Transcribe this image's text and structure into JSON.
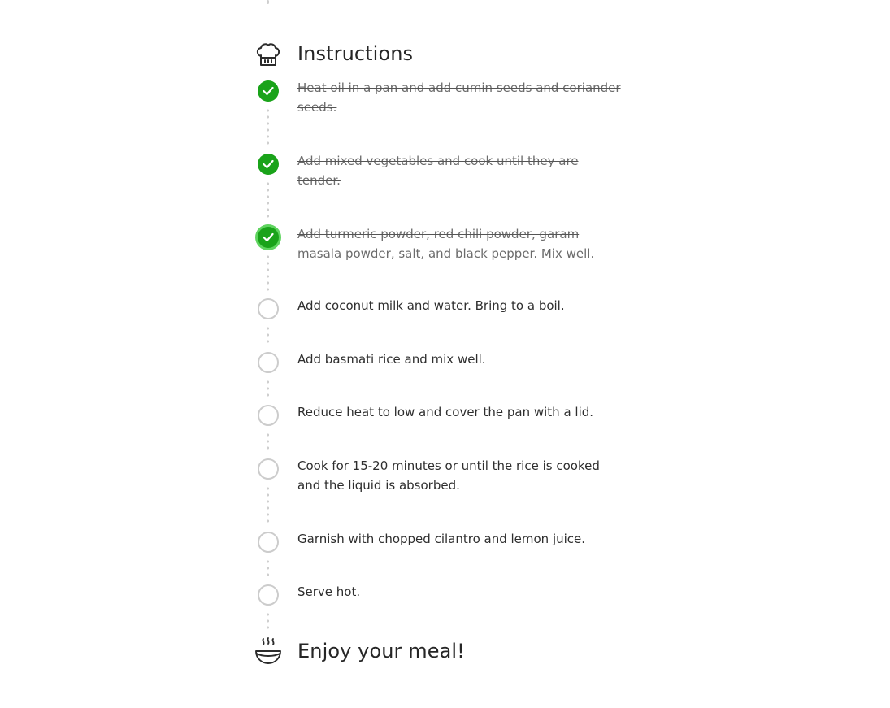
{
  "instructions": {
    "title": "Instructions",
    "header_icon": "chef-hat-icon",
    "steps": [
      {
        "text": "Heat oil in a pan and add cumin seeds and coriander seeds.",
        "completed": true
      },
      {
        "text": "Add mixed vegetables and cook until they are tender.",
        "completed": true
      },
      {
        "text": "Add turmeric powder, red chili powder, garam masala powder, salt, and black pepper. Mix well.",
        "completed": true
      },
      {
        "text": "Add coconut milk and water. Bring to a boil.",
        "completed": false
      },
      {
        "text": "Add basmati rice and mix well.",
        "completed": false
      },
      {
        "text": "Reduce heat to low and cover the pan with a lid.",
        "completed": false
      },
      {
        "text": "Cook for 15-20 minutes or until the rice is cooked and the liquid is absorbed.",
        "completed": false
      },
      {
        "text": "Garnish with chopped cilantro and lemon juice.",
        "completed": false
      },
      {
        "text": "Serve hot.",
        "completed": false
      }
    ]
  },
  "footer": {
    "title": "Enjoy your meal!",
    "icon": "hot-bowl-icon"
  },
  "colors": {
    "done": "#1aa31a",
    "todo_border": "#cccccc",
    "dots": "#cfcfcf"
  }
}
